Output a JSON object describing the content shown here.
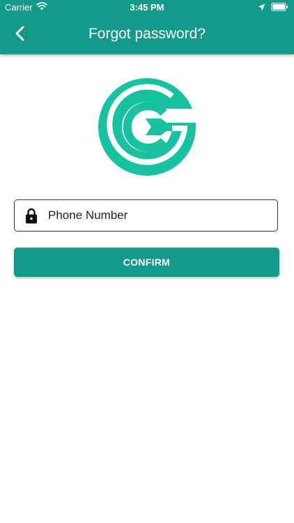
{
  "status_bar": {
    "carrier": "Carrier",
    "time": "3:45 PM",
    "wifi_icon": "wifi-icon",
    "location_icon": "location-arrow-icon",
    "battery_icon": "battery-icon"
  },
  "nav": {
    "title": "Forgot password?",
    "back_icon": "chevron-left-icon"
  },
  "logo": {
    "icon": "wrench-g-logo",
    "color": "#17c2a0"
  },
  "form": {
    "phone_placeholder": "Phone Number",
    "phone_value": "",
    "lock_icon": "lock-icon",
    "confirm_label": "CONFIRM"
  },
  "colors": {
    "primary": "#149a8a",
    "logo_accent": "#17c2a0",
    "background": "#ffffff",
    "text": "#222222"
  }
}
